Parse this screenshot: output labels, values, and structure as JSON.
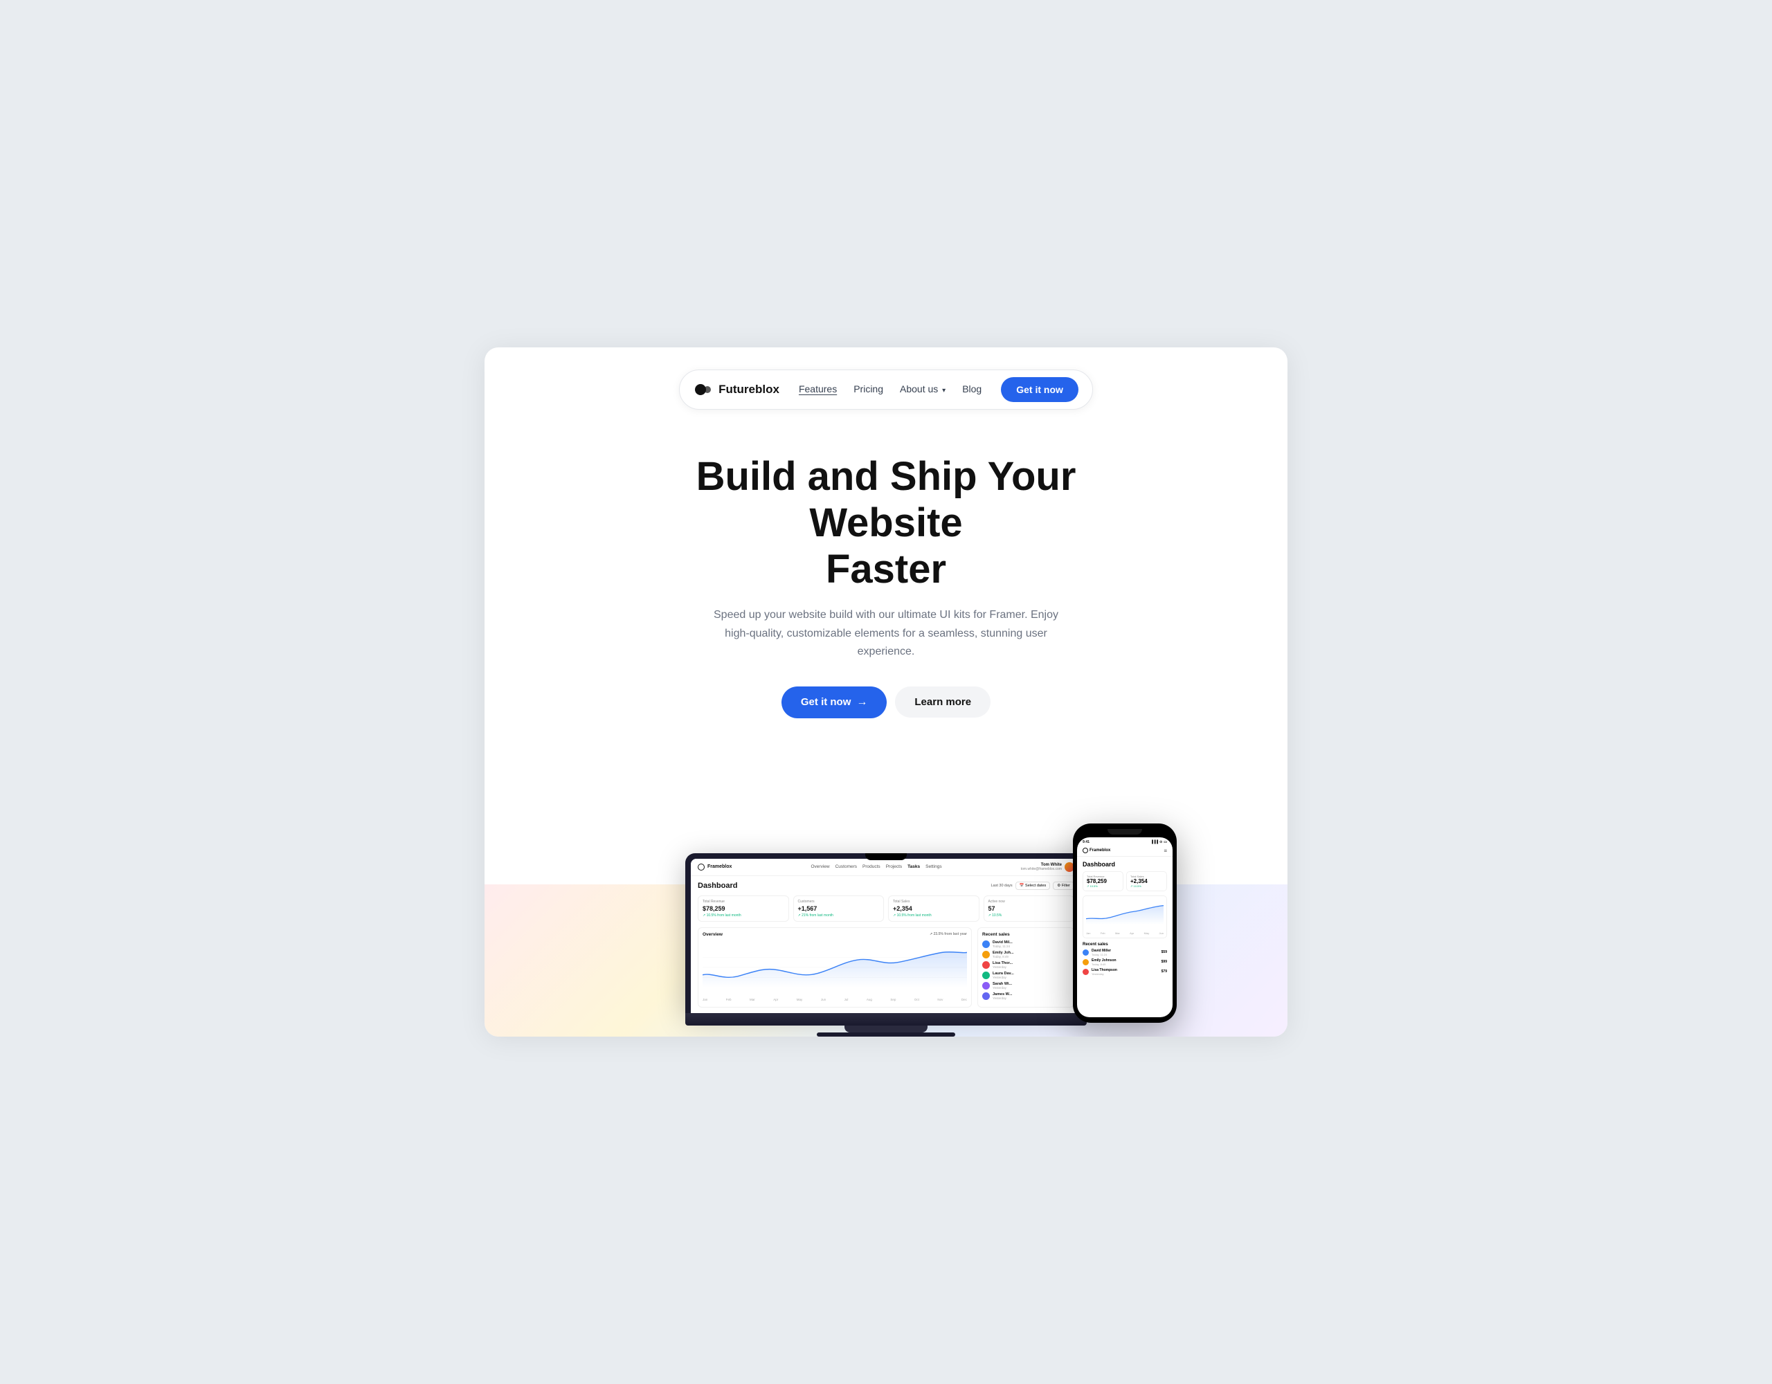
{
  "page": {
    "bg_color": "#e8ecf0"
  },
  "navbar": {
    "logo_text": "Futureblox",
    "links": [
      {
        "label": "Features",
        "active": true
      },
      {
        "label": "Pricing",
        "active": false
      },
      {
        "label": "About us",
        "active": false,
        "dropdown": true
      },
      {
        "label": "Blog",
        "active": false
      }
    ],
    "cta_label": "Get it now"
  },
  "hero": {
    "title_line1": "Build and Ship Your Website",
    "title_line2": "Faster",
    "subtitle": "Speed up your website build with our ultimate UI kits for Framer. Enjoy high-quality, customizable elements for a seamless, stunning user experience.",
    "btn_primary": "Get it now",
    "btn_secondary": "Learn more"
  },
  "dashboard": {
    "brand": "Frameblox",
    "title": "Dashboard",
    "nav_items": [
      "Overview",
      "Customers",
      "Products",
      "Projects",
      "Tasks",
      "Settings"
    ],
    "user_name": "Tom White",
    "user_email": "tom.white@frameblox.com",
    "filter_period": "Last 30 days",
    "stats": [
      {
        "label": "Total Revenue",
        "value": "$78,259",
        "change": "↗ 10.5% from last month"
      },
      {
        "label": "Customers",
        "value": "+1,567",
        "change": "↗ 21% from last month"
      },
      {
        "label": "Total Sales",
        "value": "+2,354",
        "change": "↗ 10.5% from last month"
      },
      {
        "label": "Active now",
        "value": "57",
        "change": "↗ 10.5%"
      }
    ],
    "chart_title": "Overview",
    "chart_legend": "↗ 23.5% from last year",
    "chart_x_labels": [
      "Jan",
      "Feb",
      "Mar",
      "Apr",
      "May",
      "Jun",
      "Jul",
      "Aug",
      "Sep",
      "Oct",
      "Nov",
      "Dec"
    ],
    "recent_sales_title": "Recent sales",
    "recent_sales": [
      {
        "name": "David Mil...",
        "date": "Today, 11:24",
        "color": "#3b82f6"
      },
      {
        "name": "Emily Joh...",
        "date": "Today, 8:49",
        "color": "#f59e0b"
      },
      {
        "name": "Lisa Thor...",
        "date": "Yesterday",
        "color": "#ef4444"
      },
      {
        "name": "Laura Dav...",
        "date": "Yesterday",
        "color": "#10b981"
      },
      {
        "name": "Sarah Wi...",
        "date": "Yesterday",
        "color": "#8b5cf6"
      },
      {
        "name": "James W...",
        "date": "Yesterday",
        "color": "#6366f1"
      }
    ]
  },
  "phone_dashboard": {
    "time": "9:41",
    "brand": "Frameblox",
    "title": "Dashboard",
    "stats": [
      {
        "label": "Total Revenue",
        "value": "$78,259",
        "change": "↗ 10.5%"
      },
      {
        "label": "Total Sales",
        "value": "+2,354",
        "change": "↗ 10.5%"
      }
    ],
    "chart_labels": [
      "Jan",
      "Feb",
      "Mar",
      "Apr",
      "May",
      "Jun"
    ],
    "recent_title": "Recent sales",
    "recent": [
      {
        "name": "David Miller",
        "date": "Today, 11:24",
        "amount": "$59",
        "color": "#3b82f6"
      },
      {
        "name": "Emily Johnson",
        "date": "Today, 8:49",
        "amount": "$99",
        "color": "#f59e0b"
      },
      {
        "name": "Lisa Thompson",
        "date": "Yesterday",
        "amount": "$79",
        "color": "#ef4444"
      }
    ]
  }
}
